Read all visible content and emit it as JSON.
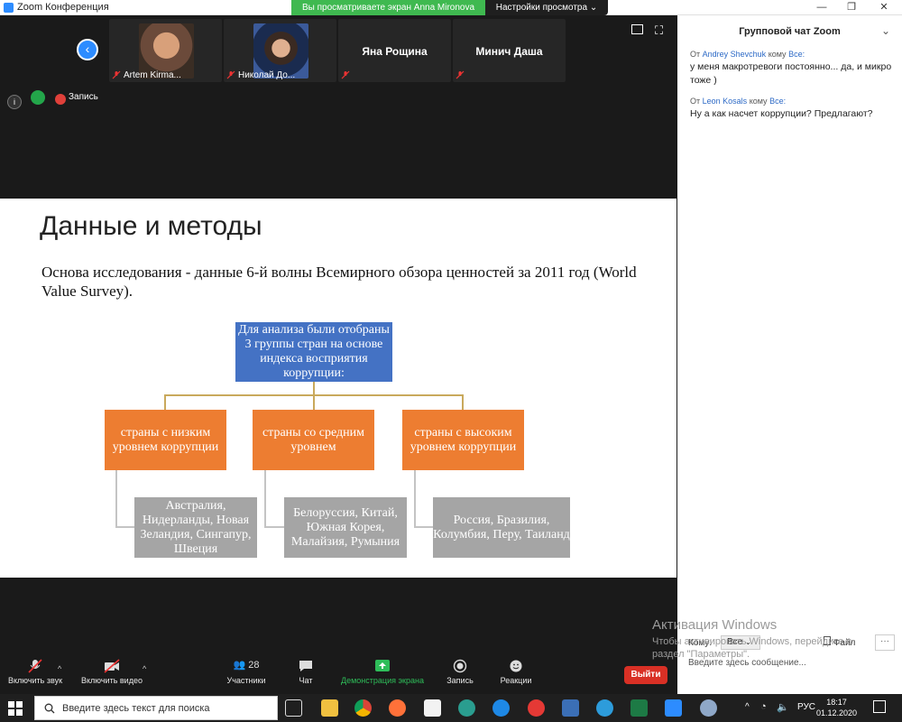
{
  "window": {
    "title": "Zoom Конференция",
    "share_notice": "Вы просматриваете экран Anna Mironova",
    "view_options": "Настройки просмотра"
  },
  "participants": [
    {
      "name": "Artem Kirma...",
      "has_video": true
    },
    {
      "name": "Николай До...",
      "has_video": true
    },
    {
      "name": "Яна Рощина",
      "has_video": false
    },
    {
      "name": "Минич Даша",
      "has_video": false
    }
  ],
  "meeting_status": {
    "recording_label": "Запись"
  },
  "slide": {
    "title": "Данные и методы",
    "body": "Основа исследования - данные 6-й волны Всемирного обзора ценностей за 2011 год (World Value Survey).",
    "diagram": {
      "root": "Для анализа были отобраны 3 группы стран на основе индекса восприятия коррупции:",
      "groups": [
        {
          "label": "страны с низким уровнем коррупции",
          "countries": "Австралия, Нидерланды, Новая Зеландия, Сингапур, Швеция"
        },
        {
          "label": "страны со средним уровнем",
          "countries": "Белоруссия, Китай, Южная Корея, Малайзия, Румыния"
        },
        {
          "label": "страны с высоким уровнем коррупции",
          "countries": "Россия, Бразилия, Колумбия, Перу, Таиланд"
        }
      ]
    }
  },
  "toolbar": {
    "unmute": "Включить звук",
    "start_video": "Включить видео",
    "participants": "Участники",
    "participants_count": "28",
    "chat": "Чат",
    "share_screen": "Демонстрация экрана",
    "record": "Запись",
    "reactions": "Реакции",
    "leave": "Выйти"
  },
  "chat": {
    "title": "Групповой чат Zoom",
    "messages": [
      {
        "from_label": "От",
        "from": "Andrey Shevchuk",
        "to_label": "кому",
        "to": "Все:",
        "text": "у меня макротревоги постоянно... да, и микро тоже )"
      },
      {
        "from_label": "От",
        "from": "Leon Kosals",
        "to_label": "кому",
        "to": "Все:",
        "text": "Ну а как насчет коррупции? Предлагают?"
      }
    ],
    "to_label": "Кому:",
    "to_value": "Все",
    "file_button": "Файл",
    "input_placeholder": "Введите здесь сообщение..."
  },
  "os": {
    "watermark_title": "Активация Windows",
    "watermark_text": "Чтобы активировать Windows, перейдите в раздел \"Параметры\".",
    "search_placeholder": "Введите здесь текст для поиска",
    "language": "РУС",
    "time": "18:17",
    "date": "01.12.2020"
  }
}
